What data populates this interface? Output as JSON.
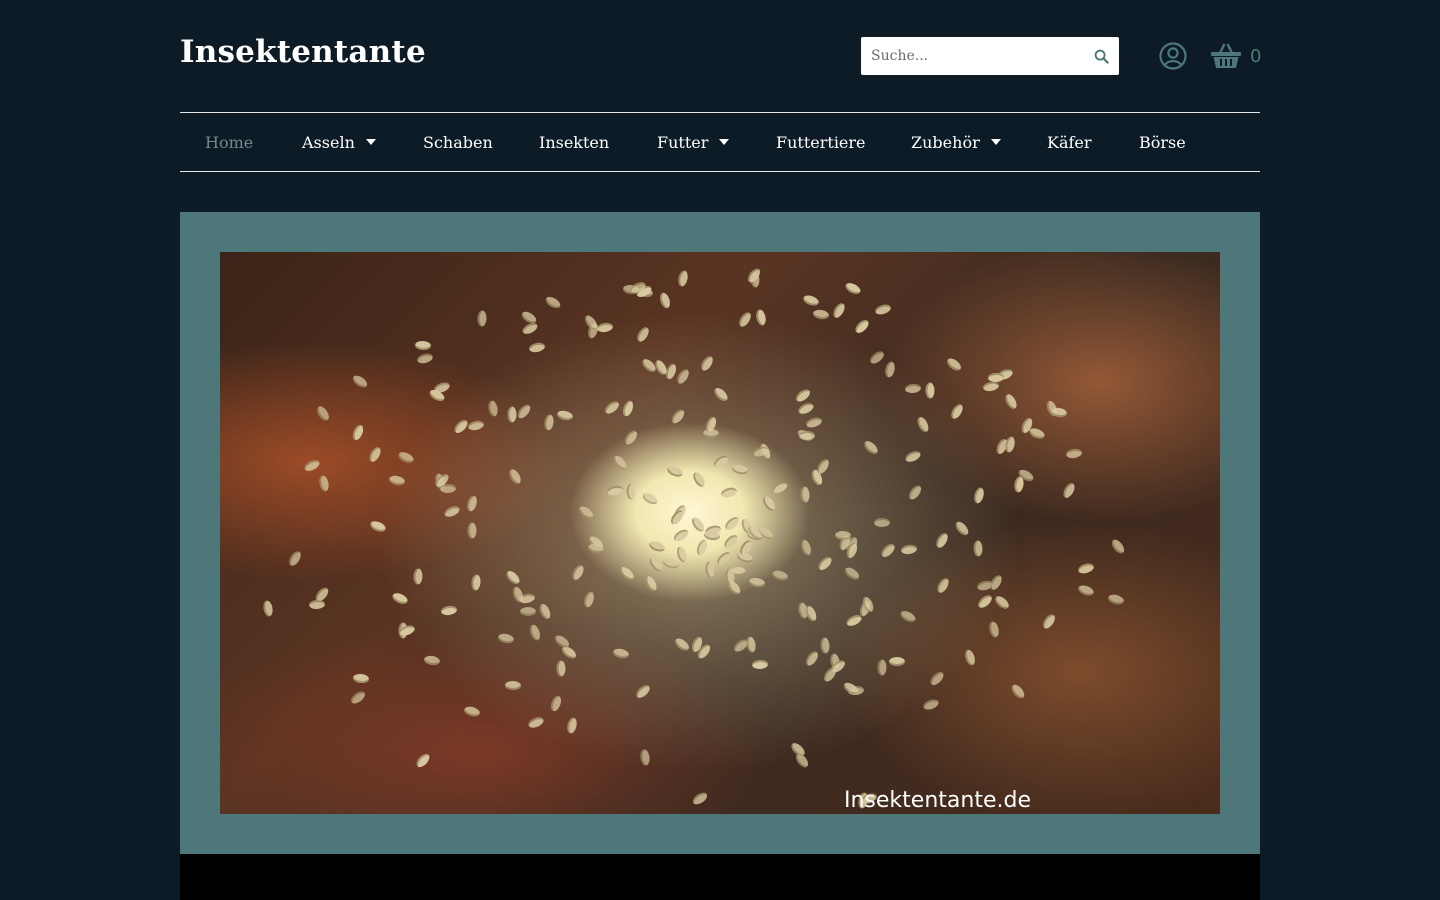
{
  "site": {
    "title": "Insektentante"
  },
  "search": {
    "placeholder": "Suche..."
  },
  "cart": {
    "count": "0"
  },
  "nav": {
    "items": [
      {
        "label": "Home",
        "active": true,
        "dropdown": false
      },
      {
        "label": "Asseln",
        "active": false,
        "dropdown": true
      },
      {
        "label": "Schaben",
        "active": false,
        "dropdown": false
      },
      {
        "label": "Insekten",
        "active": false,
        "dropdown": false
      },
      {
        "label": "Futter",
        "active": false,
        "dropdown": true
      },
      {
        "label": "Futtertiere",
        "active": false,
        "dropdown": false
      },
      {
        "label": "Zubehör",
        "active": false,
        "dropdown": true
      },
      {
        "label": "Käfer",
        "active": false,
        "dropdown": false
      },
      {
        "label": "Börse",
        "active": false,
        "dropdown": false
      }
    ]
  },
  "hero": {
    "watermark": "Insektentante.de"
  },
  "icons": {
    "search": "search-icon",
    "account": "user-circle-icon",
    "cart": "basket-icon"
  },
  "colors": {
    "background": "#0d1b26",
    "accent": "#4e7779",
    "active_nav": "#6f8a8f"
  }
}
